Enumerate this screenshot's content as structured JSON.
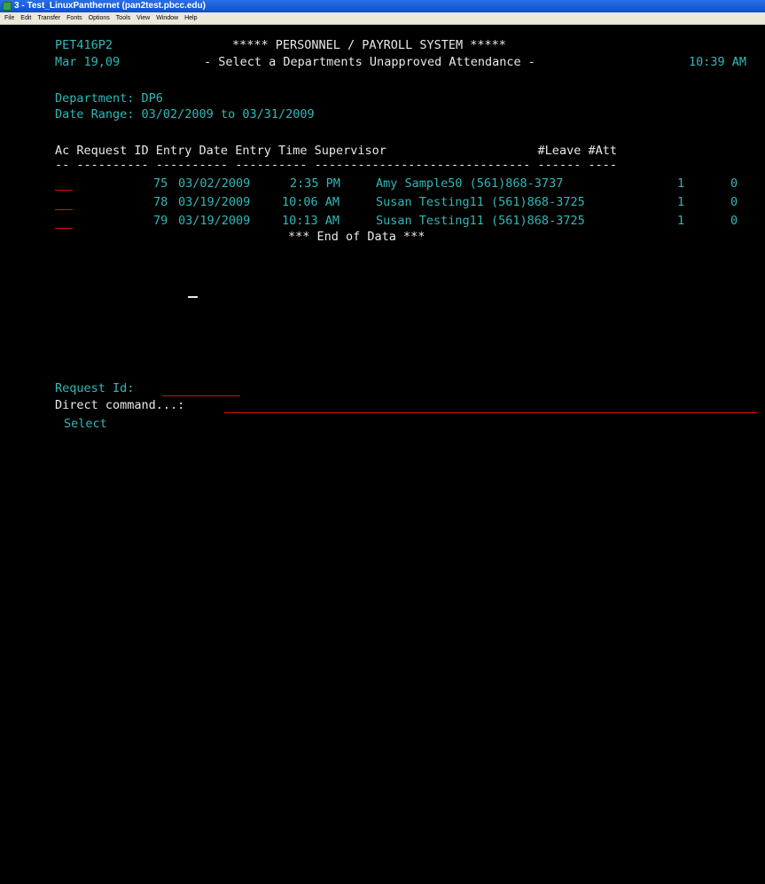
{
  "window": {
    "title": "3 - Test_LinuxPanthernet (pan2test.pbcc.edu)",
    "menu": [
      "File",
      "Edit",
      "Transfer",
      "Fonts",
      "Options",
      "Tools",
      "View",
      "Window",
      "Help"
    ]
  },
  "header": {
    "program_id": "PET416P2",
    "system_title": "***** PERSONNEL / PAYROLL SYSTEM *****",
    "date": "Mar 19,09",
    "screen_title": "- Select a Departments Unapproved Attendance -",
    "time": "10:39 AM"
  },
  "filters": {
    "department_line": "Department: DP6",
    "date_range_line": "Date Range: 03/02/2009 to 03/31/2009"
  },
  "table": {
    "header_line": "Ac Request ID Entry Date Entry Time Supervisor                     #Leave #Att",
    "divider_line": "-- ---------- ---------- ---------- ------------------------------ ------ ----",
    "rows": [
      {
        "id": "75",
        "date": "03/02/2009",
        "time": "2:35 PM",
        "supervisor": "Amy Sample50 (561)868-3737",
        "leave": "1",
        "att": "0"
      },
      {
        "id": "78",
        "date": "03/19/2009",
        "time": "10:06 AM",
        "supervisor": "Susan Testing11 (561)868-3725",
        "leave": "1",
        "att": "0"
      },
      {
        "id": "79",
        "date": "03/19/2009",
        "time": "10:13 AM",
        "supervisor": "Susan Testing11 (561)868-3725",
        "leave": "1",
        "att": "0"
      }
    ],
    "end_of_data": "*** End of Data ***"
  },
  "footer": {
    "request_id_label": "Request Id:",
    "direct_command_label": "Direct command...:",
    "function_key": "Select"
  }
}
